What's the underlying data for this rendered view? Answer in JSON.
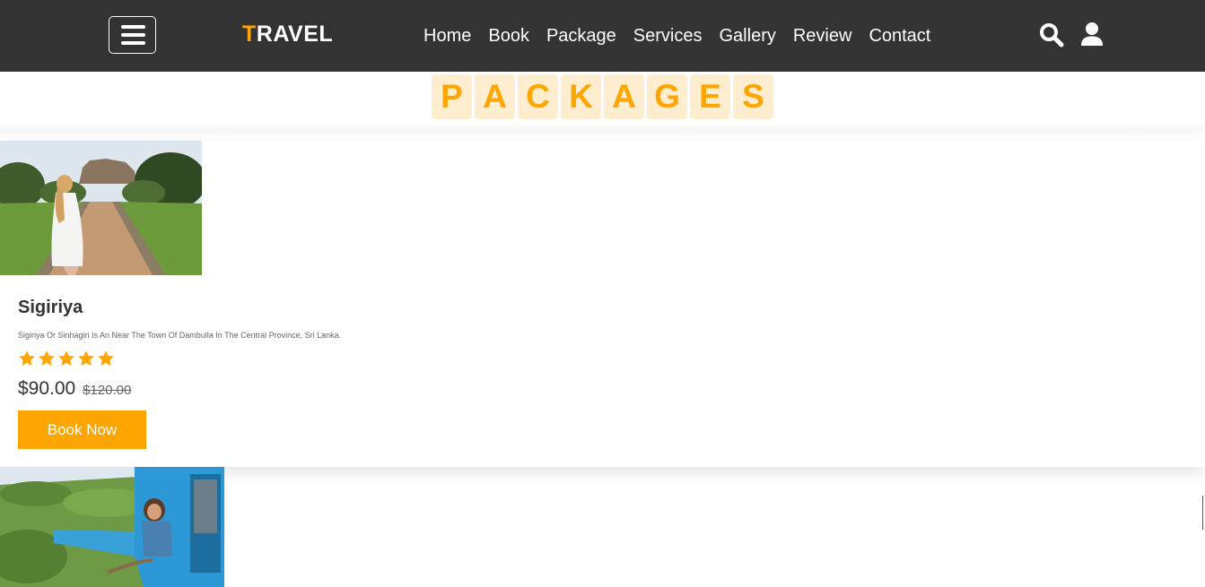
{
  "header": {
    "logo_first": "T",
    "logo_rest": "RAVEL",
    "nav": [
      "Home",
      "Book",
      "Package",
      "Services",
      "Gallery",
      "Review",
      "Contact"
    ]
  },
  "icons": {
    "menu": "hamburger-menu-icon",
    "search": "search-icon",
    "user": "user-icon",
    "star": "star-icon"
  },
  "section": {
    "heading_letters": [
      "P",
      "A",
      "C",
      "K",
      "A",
      "G",
      "E",
      "S"
    ]
  },
  "packages": [
    {
      "title": "Sigiriya",
      "description": "Sigiriya Or Sinhagiri Is An Near The Town Of Dambulla In The Central Province, Sri Lanka.",
      "rating": 5,
      "price": "$90.00",
      "old_price": "$120.00",
      "button": "Book Now"
    }
  ],
  "colors": {
    "accent": "#ffa500",
    "header_bg": "#333333",
    "letter_bg": "#ffedd0"
  }
}
